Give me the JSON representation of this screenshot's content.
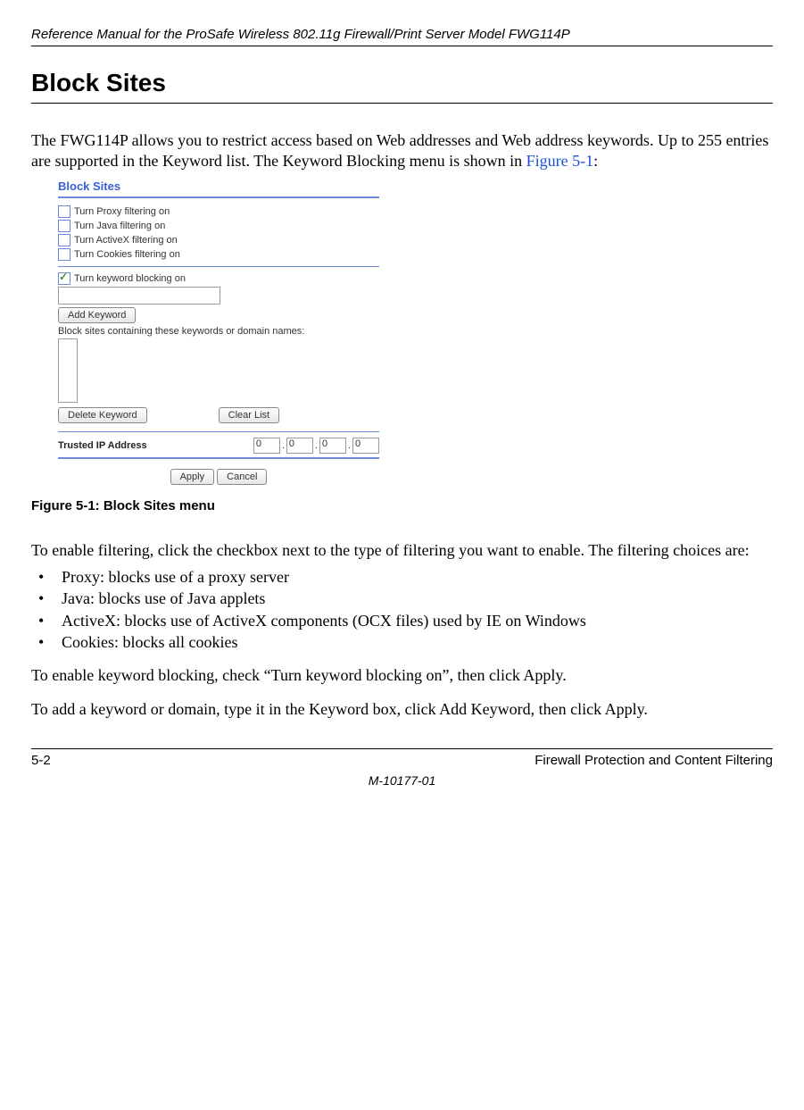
{
  "header": {
    "running_head": "Reference Manual for the ProSafe Wireless 802.11g  Firewall/Print Server Model FWG114P"
  },
  "section": {
    "title": "Block Sites"
  },
  "intro": {
    "para": "The FWG114P allows you to restrict access based on Web addresses and Web address keywords. Up to 255 entries are supported in the Keyword list. The Keyword Blocking menu is shown in ",
    "figref": "Figure 5-1",
    "tail": ":"
  },
  "screenshot": {
    "title": "Block Sites",
    "checkboxes": {
      "proxy": "Turn Proxy filtering on",
      "java": "Turn Java filtering on",
      "activex": "Turn ActiveX filtering on",
      "cookies": "Turn Cookies filtering on",
      "keyword": "Turn keyword blocking on"
    },
    "buttons": {
      "add_keyword": "Add Keyword",
      "delete_keyword": "Delete Keyword",
      "clear_list": "Clear List",
      "apply": "Apply",
      "cancel": "Cancel"
    },
    "labels": {
      "block_sites_containing": "Block sites containing these keywords or domain names:",
      "trusted_ip": "Trusted IP Address"
    },
    "ip": {
      "o1": "0",
      "o2": "0",
      "o3": "0",
      "o4": "0"
    }
  },
  "figure_caption": "Figure 5-1:  Block Sites menu",
  "para2": "To enable filtering, click the checkbox next to the type of filtering you want to enable. The filtering choices are:",
  "bullets": {
    "b1": "Proxy: blocks use of a proxy server",
    "b2": "Java: blocks use of Java applets",
    "b3": "ActiveX: blocks use of ActiveX components (OCX files) used by IE on Windows",
    "b4": "Cookies: blocks all cookies"
  },
  "para3": "To enable keyword blocking, check “Turn keyword blocking on”, then click Apply.",
  "para4": "To add a keyword or domain, type it in the Keyword box, click Add Keyword, then click Apply.",
  "footer": {
    "page": "5-2",
    "chapter": "Firewall Protection and Content Filtering",
    "docnum": "M-10177-01"
  }
}
